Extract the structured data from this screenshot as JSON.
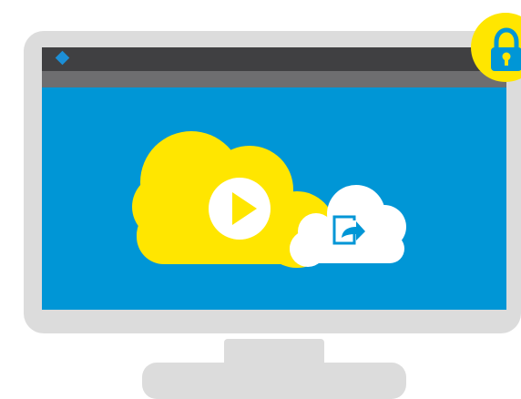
{
  "scene": {
    "screen_color": "#0096d6",
    "frame_color": "#dcdcdc",
    "titlebar_color": "#404042",
    "toolbar_color": "#6e6e70",
    "cloud_primary_color": "#ffe600",
    "cloud_secondary_color": "#ffffff",
    "lock_color": "#ffe600",
    "icons": [
      "app-diamond-icon",
      "play-icon",
      "share-export-icon",
      "padlock-icon"
    ]
  }
}
